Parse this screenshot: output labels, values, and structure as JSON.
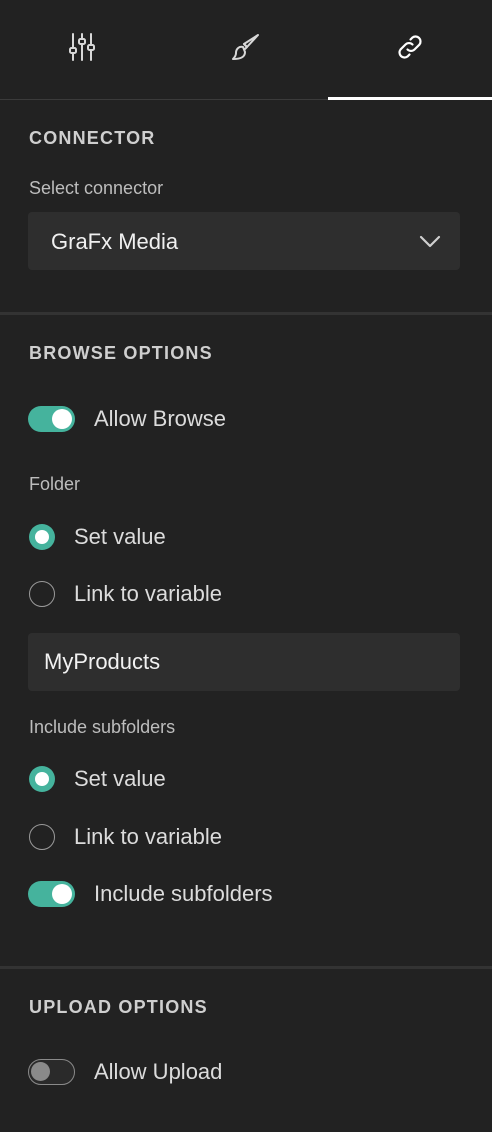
{
  "tabs": [
    {
      "icon": "sliders-icon",
      "active": false
    },
    {
      "icon": "brush-icon",
      "active": false
    },
    {
      "icon": "link-icon",
      "active": true
    }
  ],
  "connector": {
    "title": "CONNECTOR",
    "select_label": "Select connector",
    "selected_value": "GraFx Media"
  },
  "browse": {
    "title": "BROWSE OPTIONS",
    "allow_browse_label": "Allow Browse",
    "allow_browse_on": true,
    "folder_label": "Folder",
    "folder_set_value_label": "Set value",
    "folder_link_variable_label": "Link to variable",
    "folder_selected": "Set value",
    "folder_value": "MyProducts",
    "subfolders_label": "Include subfolders",
    "subfolders_set_value_label": "Set value",
    "subfolders_link_variable_label": "Link to variable",
    "subfolders_selected": "Set value",
    "include_subfolders_toggle_label": "Include subfolders",
    "include_subfolders_on": true
  },
  "upload": {
    "title": "UPLOAD OPTIONS",
    "allow_upload_label": "Allow Upload",
    "allow_upload_on": false
  },
  "colors": {
    "background": "#222222",
    "accent": "#45b39d",
    "input_bg": "#2e2e2e"
  }
}
